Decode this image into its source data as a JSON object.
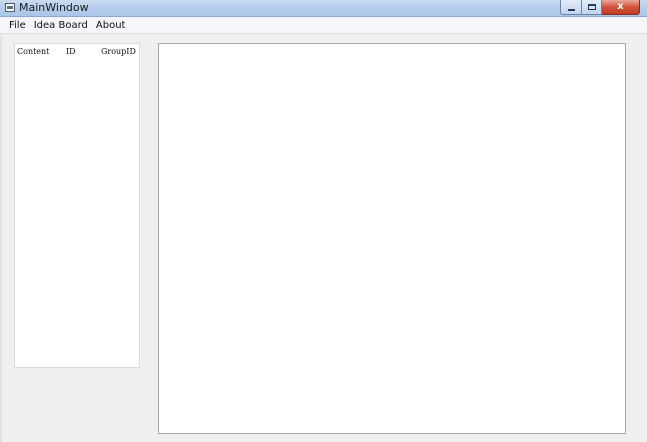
{
  "window": {
    "title": "MainWindow",
    "close_glyph": "x"
  },
  "menubar": {
    "items": [
      "File",
      "Idea Board",
      "About"
    ]
  },
  "table": {
    "columns": [
      "Content",
      "ID",
      "GroupID"
    ],
    "rows": []
  },
  "icons": {
    "app": "window-app-icon",
    "minimize": "minimize-icon",
    "maximize": "maximize-icon",
    "close": "close-icon"
  },
  "colors": {
    "close_button": "#c23a22",
    "titlebar": "#b7cfec",
    "client_background": "#efefef",
    "panel_background": "#ffffff"
  }
}
